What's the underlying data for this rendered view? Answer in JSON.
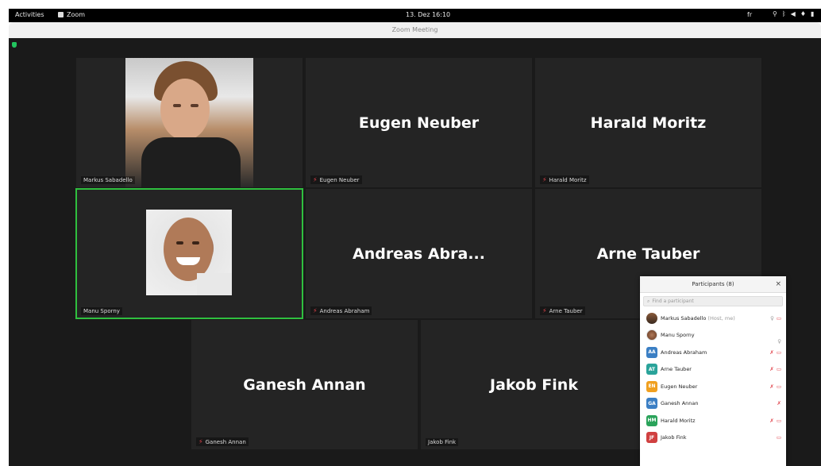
{
  "topbar": {
    "activities": "Activities",
    "app_name": "Zoom",
    "clock": "13. Dez 16:10",
    "lang": "fr",
    "tray_icons": [
      "wifi-icon",
      "bluetooth-icon",
      "volume-icon",
      "microphone-icon",
      "battery-icon"
    ]
  },
  "window": {
    "title": "Zoom Meeting"
  },
  "tiles": [
    {
      "label": "Markus Sabadello",
      "big": "",
      "muted": false,
      "video": true
    },
    {
      "label": "Eugen Neuber",
      "big": "Eugen Neuber",
      "muted": true,
      "video": false
    },
    {
      "label": "Harald Moritz",
      "big": "Harald Moritz",
      "muted": true,
      "video": false
    },
    {
      "label": "Manu Sporny",
      "big": "",
      "muted": false,
      "video": true,
      "active_speaker": true
    },
    {
      "label": "Andreas Abraham",
      "big": "Andreas Abra...",
      "muted": true,
      "video": false
    },
    {
      "label": "Arne Tauber",
      "big": "Arne Tauber",
      "muted": true,
      "video": false
    },
    {
      "label": "Ganesh Annan",
      "big": "Ganesh Annan",
      "muted": true,
      "video": false
    },
    {
      "label": "Jakob Fink",
      "big": "Jakob Fink",
      "muted": false,
      "video": false
    }
  ],
  "participants_panel": {
    "title": "Participants (8)",
    "search_placeholder": "Find a participant",
    "close": "×",
    "participants": [
      {
        "name": "Markus Sabadello",
        "role": "(Host, me)",
        "initials": "",
        "color": "",
        "mic_off": false,
        "video_off": true
      },
      {
        "name": "Manu Sporny",
        "role": "",
        "initials": "",
        "color": "",
        "mic_off": false,
        "video_off": false
      },
      {
        "name": "Andreas Abraham",
        "role": "",
        "initials": "AA",
        "color": "#3b7fc4",
        "mic_off": true,
        "video_off": true
      },
      {
        "name": "Arne Tauber",
        "role": "",
        "initials": "AT",
        "color": "#2aa39a",
        "mic_off": true,
        "video_off": true
      },
      {
        "name": "Eugen Neuber",
        "role": "",
        "initials": "EN",
        "color": "#f0a020",
        "mic_off": true,
        "video_off": true
      },
      {
        "name": "Ganesh Annan",
        "role": "",
        "initials": "GA",
        "color": "#3b7fc4",
        "mic_off": true,
        "video_off": false
      },
      {
        "name": "Harald Moritz",
        "role": "",
        "initials": "HM",
        "color": "#2aa35a",
        "mic_off": true,
        "video_off": true
      },
      {
        "name": "Jakob Fink",
        "role": "",
        "initials": "JF",
        "color": "#d04040",
        "mic_off": false,
        "video_off": true
      }
    ]
  }
}
